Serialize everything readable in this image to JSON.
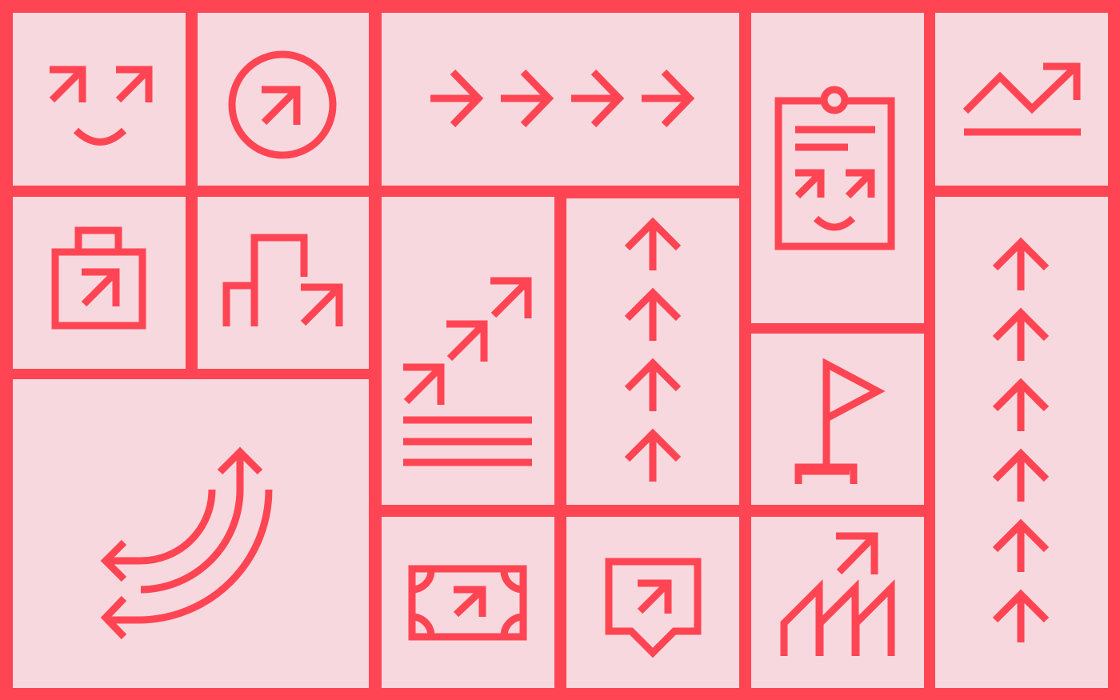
{
  "colors": {
    "frame": "#FF4553",
    "tile": "#F7D8DE",
    "stroke": "#FF4553"
  },
  "tiles": [
    {
      "id": "tile-smiley-arrows",
      "icon": "smiley-arrows-icon"
    },
    {
      "id": "tile-circle-arrow",
      "icon": "circle-arrow-icon"
    },
    {
      "id": "tile-right-arrows",
      "icon": "right-arrows-icon"
    },
    {
      "id": "tile-clipboard-face",
      "icon": "clipboard-face-icon"
    },
    {
      "id": "tile-line-chart",
      "icon": "line-chart-icon"
    },
    {
      "id": "tile-briefcase",
      "icon": "briefcase-arrow-icon"
    },
    {
      "id": "tile-steps-arrow",
      "icon": "steps-arrow-icon"
    },
    {
      "id": "tile-stair-arrows",
      "icon": "stair-arrows-icon"
    },
    {
      "id": "tile-up-arrows-4",
      "icon": "up-arrows-icon"
    },
    {
      "id": "tile-up-arrows-6",
      "icon": "up-arrows-icon"
    },
    {
      "id": "tile-flag",
      "icon": "flag-icon"
    },
    {
      "id": "tile-exchange",
      "icon": "exchange-arrows-icon"
    },
    {
      "id": "tile-banknote",
      "icon": "banknote-arrow-icon"
    },
    {
      "id": "tile-speech",
      "icon": "speech-bubble-arrow-icon"
    },
    {
      "id": "tile-bars",
      "icon": "growth-bars-icon"
    }
  ]
}
